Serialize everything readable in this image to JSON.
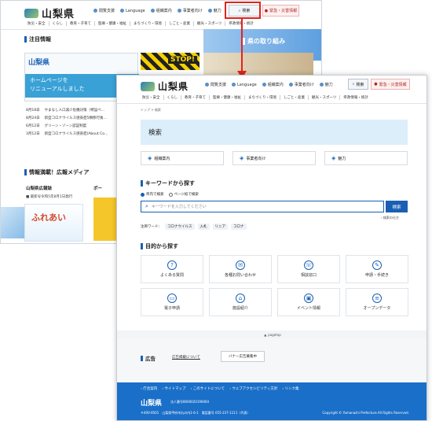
{
  "colors": {
    "accent": "#1a5fb4",
    "highlight": "#e2231a",
    "footer": "#1a6fc8",
    "title_bg": "#dceefa"
  },
  "back": {
    "logo": "山梨県",
    "toolbar": [
      {
        "label": "閲覧支援",
        "icon": "accessibility-icon"
      },
      {
        "label": "Language",
        "icon": "globe-icon"
      },
      {
        "label": "組織案内",
        "icon": "org-icon"
      },
      {
        "label": "事業者向け",
        "icon": "building-icon"
      },
      {
        "label": "魅力",
        "icon": "star-icon"
      }
    ],
    "search_label": "検索",
    "emergency_label": "緊急・災害情報",
    "nav": [
      "防災・安全",
      "くらし",
      "教育・子育て",
      "医療・健康・福祉",
      "まちづくり・環境",
      "しごと・産業",
      "観光・スポーツ",
      "県政情報・統計"
    ],
    "notice_title": "注目情報",
    "banner_title": "山梨県",
    "banner_text_1": "ホームページを",
    "banner_text_2": "リニューアルしました",
    "stop_text": "STOP!",
    "pref_title": "県の取り組み",
    "news": [
      {
        "date": "8月18日",
        "text": "やまなし人口減少危機対策（特設ペ…"
      },
      {
        "date": "8月24日",
        "text": "新型コロナウイルス感染症5類移行後…"
      },
      {
        "date": "6月12日",
        "text": "グリーン・ゾーン認証制度"
      },
      {
        "date": "3月12日",
        "text": "新型コロナウイルス感染症(About Co…"
      }
    ],
    "media_title": "情報満載！広報メディア",
    "kouhou_title": "山梨県広報誌",
    "kouhou_date": "■ 最新号令和5年8月1日発行",
    "portal_label": "ポー",
    "magazine_name": "ふれあい"
  },
  "front": {
    "logo": "山梨県",
    "toolbar": [
      {
        "label": "閲覧支援",
        "icon": "accessibility-icon"
      },
      {
        "label": "Language",
        "icon": "globe-icon"
      },
      {
        "label": "組織案内",
        "icon": "org-icon"
      },
      {
        "label": "事業者向け",
        "icon": "building-icon"
      },
      {
        "label": "魅力",
        "icon": "star-icon"
      }
    ],
    "search_label": "検索",
    "emergency_label": "緊急・災害情報",
    "nav": [
      "防災・安全",
      "くらし",
      "教育・子育て",
      "医療・健康・福祉",
      "まちづくり・環境",
      "しごと・産業",
      "観光・スポーツ",
      "県政情報・統計"
    ],
    "breadcrumb": "トップ > 検索",
    "page_title": "検索",
    "quick": [
      {
        "label": "組織案内",
        "icon": "org-icon"
      },
      {
        "label": "事業者向け",
        "icon": "building-icon"
      },
      {
        "label": "魅力",
        "icon": "star-icon"
      }
    ],
    "keyword_title": "キーワードから探す",
    "radio_1": "県内で検索",
    "radio_2": "ページ絞で検索",
    "search_placeholder": "キーワードを入力してください",
    "search_button": "検索",
    "search_help": "› 検索の仕方",
    "popular_label": "注目ワード：",
    "popular": [
      "コロナウイルス",
      "入札",
      "リニア",
      "コロナ"
    ],
    "purpose_title": "目的から探す",
    "purposes": [
      {
        "label": "よくある質問",
        "icon": "faq-icon"
      },
      {
        "label": "各種お問い合わせ",
        "icon": "mail-icon"
      },
      {
        "label": "相談窓口",
        "icon": "chat-icon"
      },
      {
        "label": "申請・手続き",
        "icon": "form-icon"
      },
      {
        "label": "電子申請",
        "icon": "pc-icon"
      },
      {
        "label": "施設紹介",
        "icon": "facility-icon"
      },
      {
        "label": "イベント情報",
        "icon": "event-icon"
      },
      {
        "label": "オープンデータ",
        "icon": "data-icon"
      }
    ],
    "pagetop": "pagetop",
    "ad_title": "広告",
    "ad_about": "広告掲載について",
    "ad_button": "バナー広告募集中",
    "footer_links": [
      "庁舎案内",
      "サイトマップ",
      "このサイトについて",
      "ウェブアクセシビリティ方針",
      "リンク集"
    ],
    "footer_logo": "山梨県",
    "corp_no": "法人番号8000020190004",
    "address": "〒400-8501　山梨県甲府市丸の内1-6-1　電話番号 055-237-1111（代表）",
    "copyright": "Copyright © Yamanashi Prefecture.All Rights Reserved."
  }
}
